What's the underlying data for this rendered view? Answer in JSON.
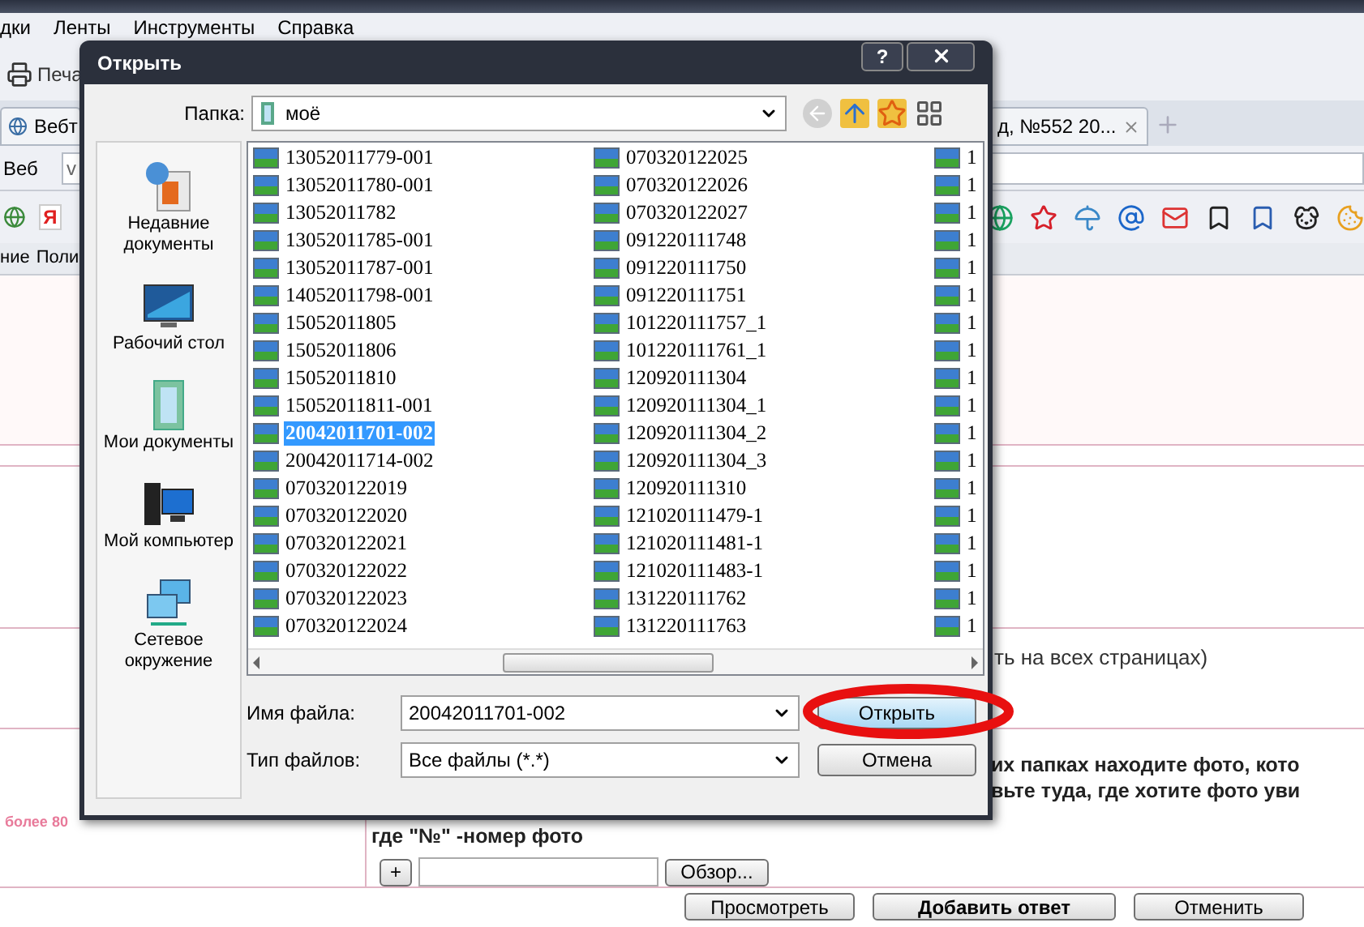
{
  "browser": {
    "menu": [
      "дки",
      "Ленты",
      "Инструменты",
      "Справка"
    ],
    "toolbar_button": "Печа",
    "tabs": [
      {
        "label": "Вебт",
        "selected": false
      },
      {
        "label": "д, №552 20...",
        "selected": false
      }
    ],
    "address_label": "Веб",
    "address_value": "v",
    "bookmark_letter": "Я",
    "menu2": [
      "ние",
      "Поли"
    ]
  },
  "page": {
    "note": "ть на всех страницах)",
    "instructions": [
      "их папках находите фото, кото",
      "вьте туда, где хотите фото уви"
    ],
    "photo_hint": "где \"№\" -номер фото",
    "side_label": "более 80",
    "add_button": "+",
    "browse_button": "Обзор...",
    "buttons": [
      {
        "label": "Просмотреть",
        "primary": false
      },
      {
        "label": "Добавить ответ",
        "primary": true
      },
      {
        "label": "Отменить",
        "primary": false
      }
    ]
  },
  "dialog": {
    "title": "Открыть",
    "help": "?",
    "folder_label": "Папка:",
    "folder": "моё",
    "places": [
      {
        "kind": "recent",
        "label": "Недавние документы"
      },
      {
        "kind": "desktop",
        "label": "Рабочий стол"
      },
      {
        "kind": "documents",
        "label": "Мои документы"
      },
      {
        "kind": "computer",
        "label": "Мой компьютер"
      },
      {
        "kind": "network",
        "label": "Сетевое окружение"
      }
    ],
    "files": [
      {
        "name": "13052011779-001",
        "selected": false
      },
      {
        "name": "13052011780-001",
        "selected": false
      },
      {
        "name": "13052011782",
        "selected": false
      },
      {
        "name": "13052011785-001",
        "selected": false
      },
      {
        "name": "13052011787-001",
        "selected": false
      },
      {
        "name": "14052011798-001",
        "selected": false
      },
      {
        "name": "15052011805",
        "selected": false
      },
      {
        "name": "15052011806",
        "selected": false
      },
      {
        "name": "15052011810",
        "selected": false
      },
      {
        "name": "15052011811-001",
        "selected": false
      },
      {
        "name": "20042011701-002",
        "selected": true
      },
      {
        "name": "20042011714-002",
        "selected": false
      },
      {
        "name": "070320122019",
        "selected": false
      },
      {
        "name": "070320122020",
        "selected": false
      },
      {
        "name": "070320122021",
        "selected": false
      },
      {
        "name": "070320122022",
        "selected": false
      },
      {
        "name": "070320122023",
        "selected": false
      },
      {
        "name": "070320122024",
        "selected": false
      },
      {
        "name": "070320122025",
        "selected": false
      },
      {
        "name": "070320122026",
        "selected": false
      },
      {
        "name": "070320122027",
        "selected": false
      },
      {
        "name": "091220111748",
        "selected": false
      },
      {
        "name": "091220111750",
        "selected": false
      },
      {
        "name": "091220111751",
        "selected": false
      },
      {
        "name": "101220111757_1",
        "selected": false
      },
      {
        "name": "101220111761_1",
        "selected": false
      },
      {
        "name": "120920111304",
        "selected": false
      },
      {
        "name": "120920111304_1",
        "selected": false
      },
      {
        "name": "120920111304_2",
        "selected": false
      },
      {
        "name": "120920111304_3",
        "selected": false
      },
      {
        "name": "120920111310",
        "selected": false
      },
      {
        "name": "121020111479-1",
        "selected": false
      },
      {
        "name": "121020111481-1",
        "selected": false
      },
      {
        "name": "121020111483-1",
        "selected": false
      },
      {
        "name": "131220111762",
        "selected": false
      },
      {
        "name": "131220111763",
        "selected": false
      },
      {
        "name": "1",
        "selected": false
      },
      {
        "name": "1",
        "selected": false
      },
      {
        "name": "1",
        "selected": false
      },
      {
        "name": "1",
        "selected": false
      },
      {
        "name": "1",
        "selected": false
      },
      {
        "name": "1",
        "selected": false
      },
      {
        "name": "1",
        "selected": false
      },
      {
        "name": "1",
        "selected": false
      },
      {
        "name": "1",
        "selected": false
      },
      {
        "name": "1",
        "selected": false
      },
      {
        "name": "1",
        "selected": false
      },
      {
        "name": "1",
        "selected": false
      },
      {
        "name": "1",
        "selected": false
      },
      {
        "name": "1",
        "selected": false
      },
      {
        "name": "1",
        "selected": false
      },
      {
        "name": "1",
        "selected": false
      },
      {
        "name": "1",
        "selected": false
      },
      {
        "name": "1",
        "selected": false
      }
    ],
    "file_name_label": "Имя файла:",
    "file_name": "20042011701-002",
    "file_type_label": "Тип файлов:",
    "file_type": "Все файлы (*.*)",
    "open_button": "Открыть",
    "cancel_button": "Отмена"
  }
}
